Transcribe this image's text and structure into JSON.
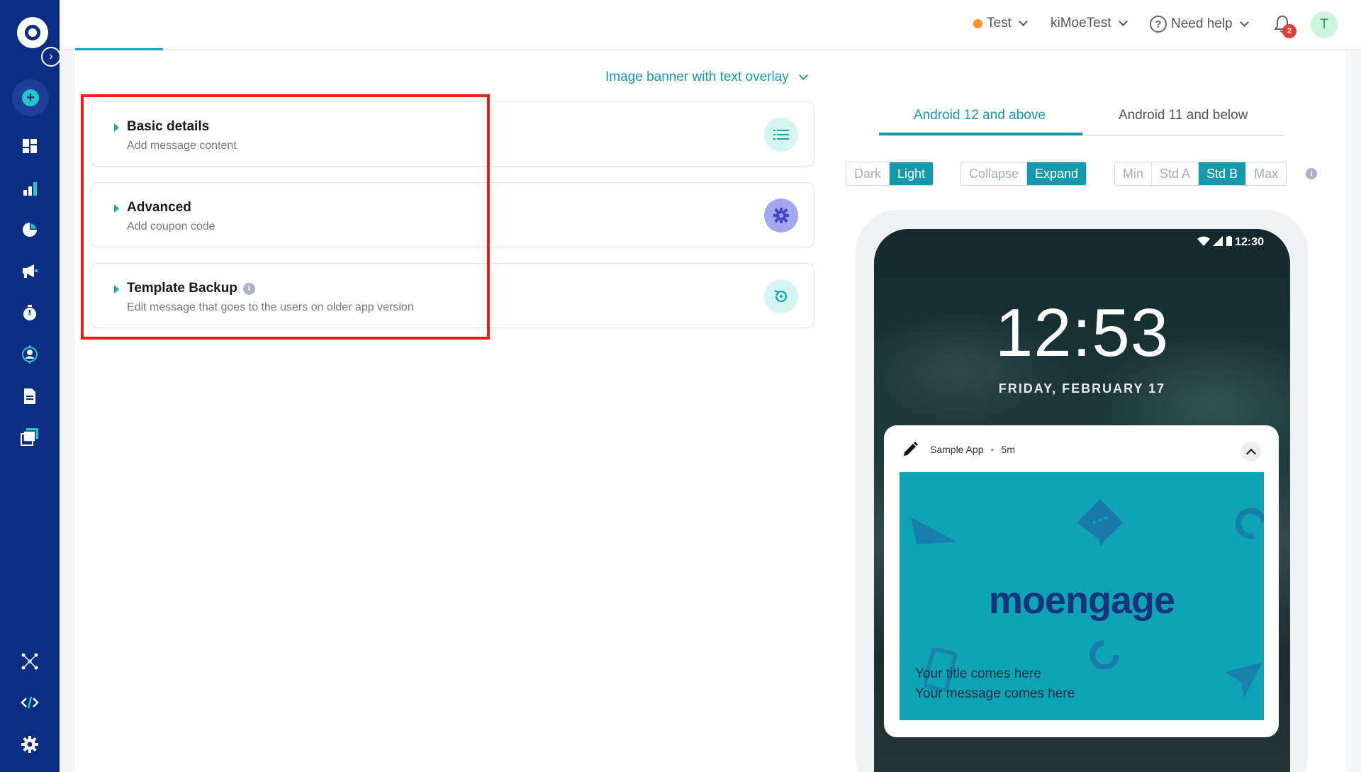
{
  "topbar": {
    "environment": "Test",
    "workspace": "kiMoeTest",
    "help": "Need help",
    "notification_count": "2",
    "avatar_initial": "T"
  },
  "template_selector": "Image banner with text overlay",
  "cards": [
    {
      "title": "Basic details",
      "subtitle": "Add message content",
      "icon": "list-icon"
    },
    {
      "title": "Advanced",
      "subtitle": "Add coupon code",
      "icon": "gear-icon"
    },
    {
      "title": "Template Backup",
      "subtitle": "Edit message that goes to the users on older app version",
      "icon": "restore-icon"
    }
  ],
  "preview": {
    "tabs": [
      "Android 12 and above",
      "Android 11 and below"
    ],
    "active_tab": "Android 12 and above",
    "theme": {
      "options": [
        "Dark",
        "Light"
      ],
      "selected": "Light"
    },
    "state": {
      "options": [
        "Collapse",
        "Expand"
      ],
      "selected": "Expand"
    },
    "size": {
      "options": [
        "Min",
        "Std A",
        "Std B",
        "Max"
      ],
      "selected": "Std B"
    },
    "phone": {
      "status_time": "12:30",
      "clock": "12:53",
      "date": "FRIDAY, FEBRUARY 17",
      "app_name": "Sample App",
      "separator": "•",
      "age": "5m",
      "brand": "moengage",
      "title": "Your title comes here",
      "message": "Your message comes here"
    }
  },
  "colors": {
    "sidebar": "#0b2d82",
    "accent": "#1599ad",
    "highlight": "#f01d11",
    "banner": "#0fa4b4"
  }
}
